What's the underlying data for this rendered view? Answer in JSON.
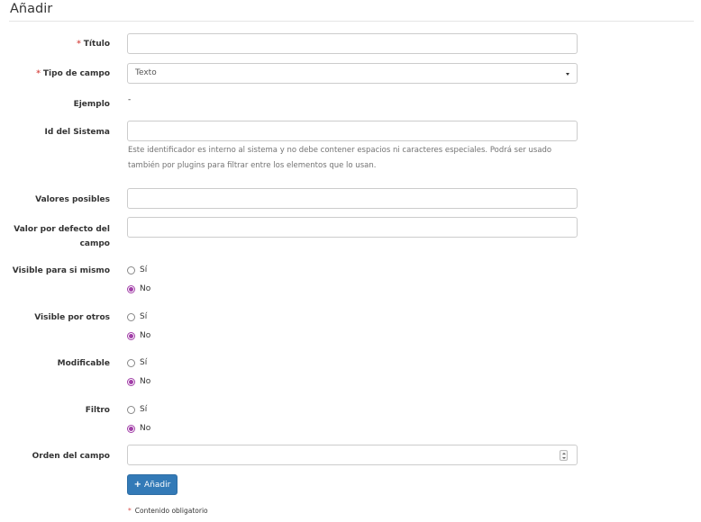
{
  "page": {
    "title": "Añadir"
  },
  "required_mark": "*",
  "fields": {
    "titulo": {
      "label": "Título",
      "value": ""
    },
    "tipo_campo": {
      "label": "Tipo de campo",
      "selected": "Texto"
    },
    "ejemplo": {
      "label": "Ejemplo",
      "value": "-"
    },
    "id_sistema": {
      "label": "Id del Sistema",
      "value": "",
      "help_line1": "Este identificador es interno al sistema y no debe contener espacios ni caracteres especiales. Podrá ser usado",
      "help_line2": "también por plugins para filtrar entre los elementos que lo usan."
    },
    "valores_posibles": {
      "label": "Valores posibles",
      "value": ""
    },
    "valor_defecto": {
      "label_line1": "Valor por defecto del",
      "label_line2": "campo",
      "value": ""
    },
    "visible_si_mismo": {
      "label": "Visible para si mismo",
      "opt_yes": "Sí",
      "opt_no": "No",
      "selected": "No"
    },
    "visible_otros": {
      "label": "Visible por otros",
      "opt_yes": "Sí",
      "opt_no": "No",
      "selected": "No"
    },
    "modificable": {
      "label": "Modificable",
      "opt_yes": "Sí",
      "opt_no": "No",
      "selected": "No"
    },
    "filtro": {
      "label": "Filtro",
      "opt_yes": "Sí",
      "opt_no": "No",
      "selected": "No"
    },
    "orden": {
      "label": "Orden del campo",
      "value": ""
    }
  },
  "submit": {
    "icon": "plus-icon",
    "label": "Añadir",
    "color": "#337ab7"
  },
  "footnote": "Contenido obligatorio",
  "colors": {
    "required": "#d9534f",
    "radio_selected": "#a23fa8"
  }
}
